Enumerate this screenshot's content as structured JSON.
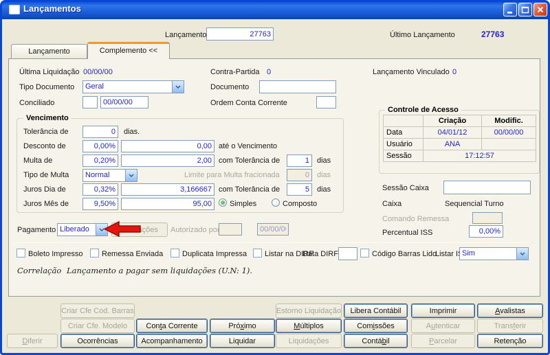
{
  "window": {
    "title": "Lançamentos"
  },
  "header": {
    "lancamento_label": "Lançamento",
    "lancamento_value": "27763",
    "ultimo_label": "Último Lançamento",
    "ultimo_value": "27763"
  },
  "tabs": {
    "lancamento": "Lançamento",
    "complemento": "Complemento <<"
  },
  "form": {
    "ultima_liquidacao_label": "Última Liquidação",
    "ultima_liquidacao_value": "00/00/00",
    "contra_partida_label": "Contra-Partida",
    "contra_partida_value": "0",
    "lancamento_vinculado_label": "Lançamento Vinculado",
    "lancamento_vinculado_value": "0",
    "tipo_documento_label": "Tipo Documento",
    "tipo_documento_value": "Geral",
    "documento_label": "Documento",
    "documento_value": "",
    "conciliado_label": "Conciliado",
    "conciliado_flag": "",
    "conciliado_date": "00/00/00",
    "ordem_label": "Ordem Conta Corrente",
    "ordem_value": ""
  },
  "venc": {
    "title": "Vencimento",
    "tolerancia_label": "Tolerância de",
    "tolerancia_value": "0",
    "tolerancia_suffix": "dias.",
    "desconto_label": "Desconto de",
    "desconto_pct": "0,00%",
    "desconto_value": "0,00",
    "desconto_suffix": "até o Vencimento",
    "multa_label": "Multa de",
    "multa_pct": "0,20%",
    "multa_value": "2,00",
    "multa_mid": "com Tolerância de",
    "multa_tol": "1",
    "multa_suffix": "dias",
    "tipo_multa_label": "Tipo de Multa",
    "tipo_multa_value": "Normal",
    "limite_label": "Limite para Multa fracionada",
    "limite_value": "0",
    "limite_suffix": "dias",
    "juros_dia_label": "Juros Dia de",
    "juros_dia_pct": "0,32%",
    "juros_dia_value": "3,166667",
    "juros_dia_mid": "com Tolerância de",
    "juros_dia_tol": "5",
    "juros_dia_suffix": "dias",
    "juros_mes_label": "Juros Mês de",
    "juros_mes_pct": "9,50%",
    "juros_mes_value": "95,00",
    "radio_simples": "Simples",
    "radio_composto": "Composto"
  },
  "acesso": {
    "title": "Controle de Acesso",
    "col_criacao": "Criação",
    "col_modific": "Modific.",
    "data_label": "Data",
    "data_criacao": "04/01/12",
    "data_modific": "00/00/00",
    "usuario_label": "Usuário",
    "usuario_criacao": "ANA",
    "usuario_modific": "",
    "sessao_label": "Sessão",
    "sessao_value": "17:12:57"
  },
  "caixa": {
    "sessao_caixa_label": "Sessão Caixa",
    "sessao_caixa_value": "",
    "caixa_label": "Caixa",
    "caixa_value": "Sequencial Turno",
    "comando_label": "Comando Remessa",
    "comando_value": "",
    "iss_label": "Percentual ISS",
    "iss_value": "0,00%"
  },
  "pag": {
    "label": "Pagamento",
    "value": "Liberado",
    "liberacoes": "Liberações",
    "autorizado_label": "Autorizado por",
    "autorizado_value": "",
    "autorizado_date": "00/00/00"
  },
  "checks": {
    "boleto": "Boleto Impresso",
    "remessa": "Remessa Enviada",
    "duplicata": "Duplicata Impressa",
    "dirf": "Listar na DIRF",
    "data_dirf_label": "Data DIRF",
    "data_dirf_value": "",
    "codigo": "Código Barras Lido",
    "listar_iss_label": "Listar ISS",
    "listar_iss_value": "Sim"
  },
  "correlacao": {
    "label": "Correlação",
    "text": "Lançamento a pagar sem liquidações (U.N: 1)."
  },
  "buttons": {
    "criar_cod_barras": {
      "label": "Criar Cfe Cod. Barras",
      "enabled": false
    },
    "criar_modelo": {
      "label": "Criar Cfe. Modelo",
      "enabled": false
    },
    "estorno": {
      "label": "Estorno Liquidação",
      "enabled": false
    },
    "libera_contabil": {
      "label": "Libera Contábil",
      "enabled": true
    },
    "imprimir": {
      "label": "Imprimir",
      "enabled": true
    },
    "avalistas": {
      "label": "Avalistas",
      "accel": "A",
      "enabled": true
    },
    "conta_corrente": {
      "label": "Conta Corrente",
      "accel": "t",
      "enabled": true
    },
    "proximo": {
      "label": "Próximo",
      "accel": "x",
      "enabled": true
    },
    "multiplos": {
      "label": "Múltiplos",
      "accel": "M",
      "enabled": true
    },
    "comissoes": {
      "label": "Comissões",
      "accel": "i",
      "enabled": true
    },
    "autenticar": {
      "label": "Autenticar",
      "accel": "u",
      "enabled": false
    },
    "transferir": {
      "label": "Transferir",
      "accel": "f",
      "enabled": false
    },
    "diferir": {
      "label": "Diferir",
      "accel": "D",
      "enabled": false
    },
    "ocorrencias": {
      "label": "Ocorrências",
      "enabled": true
    },
    "acompanhamento": {
      "label": "Acompanhamento",
      "enabled": true
    },
    "liquidar": {
      "label": "Liquidar",
      "enabled": true
    },
    "liquidacoes": {
      "label": "Liquidações",
      "enabled": false
    },
    "contabil": {
      "label": "Contábil",
      "accel": "b",
      "enabled": true
    },
    "parcelar": {
      "label": "Parcelar",
      "accel": "P",
      "enabled": false
    },
    "retencao": {
      "label": "Retenção",
      "enabled": true
    }
  }
}
